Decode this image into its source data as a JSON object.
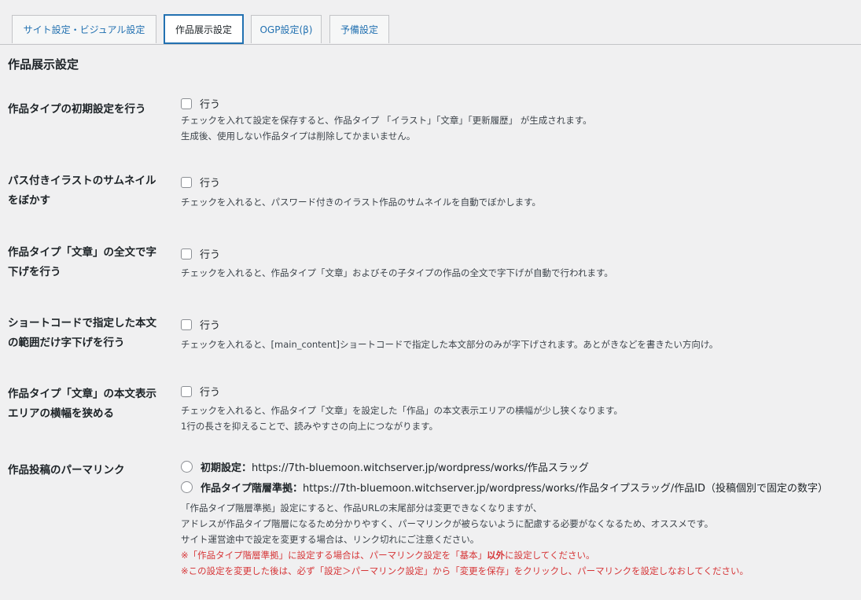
{
  "tabs": [
    {
      "label": "サイト設定・ビジュアル設定"
    },
    {
      "label": "作品展示設定"
    },
    {
      "label": "OGP設定(β)"
    },
    {
      "label": "予備設定"
    }
  ],
  "page_title": "作品展示設定",
  "rows": [
    {
      "label_lines": [
        "作品タイプの初期設定を行う"
      ],
      "option": "行う",
      "desc": [
        "チェックを入れて設定を保存すると、作品タイプ 「イラスト」「文章」「更新履歴」 が生成されます。",
        "生成後、使用しない作品タイプは削除してかまいません。"
      ]
    },
    {
      "label_lines": [
        "パス付きイラストのサムネイル",
        "をぼかす"
      ],
      "option": "行う",
      "desc": [
        "チェックを入れると、パスワード付きのイラスト作品のサムネイルを自動でぼかします。"
      ]
    },
    {
      "label_lines": [
        "作品タイプ「文章」の全文で字",
        "下げを行う"
      ],
      "option": "行う",
      "desc": [
        "チェックを入れると、作品タイプ「文章」およびその子タイプの作品の全文で字下げが自動で行われます。"
      ]
    },
    {
      "label_lines": [
        "ショートコードで指定した本文",
        "の範囲だけ字下げを行う"
      ],
      "option": "行う",
      "desc": [
        "チェックを入れると、[main_content]ショートコードで指定した本文部分のみが字下げされます。あとがきなどを書きたい方向け。"
      ]
    },
    {
      "label_lines": [
        "作品タイプ「文章」の本文表示",
        "エリアの横幅を狭める"
      ],
      "option": "行う",
      "desc": [
        "チェックを入れると、作品タイプ「文章」を設定した「作品」の本文表示エリアの横幅が少し狭くなります。",
        "1行の長さを抑えることで、読みやすさの向上につながります。"
      ]
    }
  ],
  "permalink": {
    "label": "作品投稿のパーマリンク",
    "options": [
      {
        "name": "初期設定：",
        "url": "https://7th-bluemoon.witchserver.jp/wordpress/works/作品スラッグ"
      },
      {
        "name": "作品タイプ階層準拠：",
        "url": "https://7th-bluemoon.witchserver.jp/wordpress/works/作品タイプスラッグ/作品ID（投稿個別で固定の数字）"
      }
    ],
    "desc": [
      "「作品タイプ階層準拠」設定にすると、作品URLの末尾部分は変更できなくなりますが、",
      "アドレスが作品タイプ階層になるため分かりやすく、パーマリンクが被らないように配慮する必要がなくなるため、オススメです。",
      "サイト運営途中で設定を変更する場合は、リンク切れにご注意ください。"
    ],
    "warning1_pre": "※「作品タイプ階層準拠」に設定する場合は、パーマリンク設定を「基本」",
    "warning1_bold": "以外",
    "warning1_post": "に設定してください。",
    "warning2": "※この設定を変更した後は、必ず「設定＞パーマリンク設定」から「変更を保存」をクリックし、パーマリンクを設定しなおしてください。"
  },
  "colors": {
    "accent": "#2271b1",
    "warning": "#d63638",
    "background": "#f0f0f1"
  }
}
